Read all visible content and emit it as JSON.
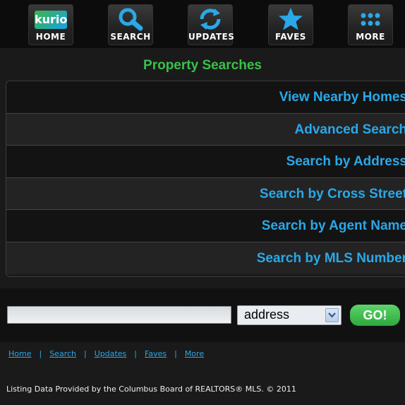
{
  "nav": {
    "home": {
      "logo": "kurio",
      "label": "HOME"
    },
    "search": {
      "label": "SEARCH"
    },
    "updates": {
      "label": "UPDATES"
    },
    "faves": {
      "label": "FAVES"
    },
    "more": {
      "label": "MORE"
    }
  },
  "page_title": "Property Searches",
  "search_options": [
    "View Nearby Homes",
    "Advanced Search",
    "Search by Address",
    "Search by Cross Street",
    "Search by Agent Name",
    "Search by MLS Number"
  ],
  "quick_search": {
    "input_value": "",
    "select_value": "address",
    "go_label": "GO!"
  },
  "footer": {
    "links": [
      "Home",
      "Search",
      "Updates",
      "Faves",
      "More"
    ],
    "separator": "|",
    "credit": "Listing Data Provided by the Columbus Board of REALTORS® MLS. © 2011"
  },
  "colors": {
    "accent_green": "#39c14b",
    "link_blue": "#2aa8e8",
    "background": "#1a1a1a"
  }
}
